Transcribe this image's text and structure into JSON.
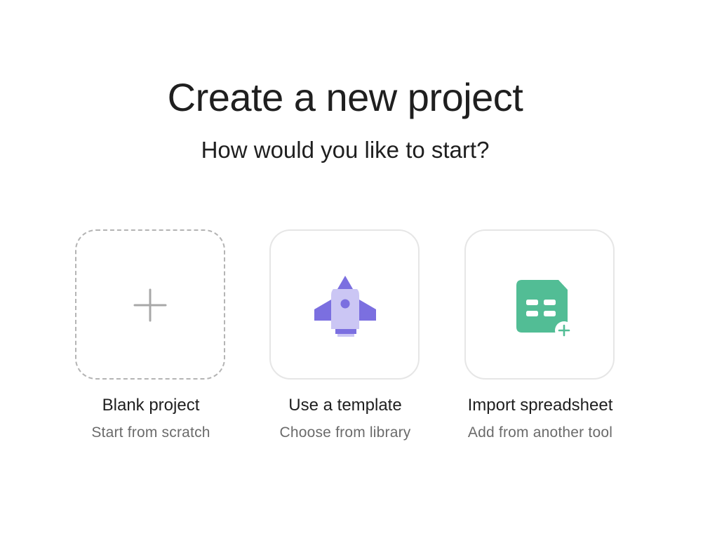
{
  "header": {
    "title": "Create a new project",
    "subtitle": "How would you like to start?"
  },
  "options": [
    {
      "label": "Blank project",
      "description": "Start from scratch",
      "icon": "plus-icon"
    },
    {
      "label": "Use a template",
      "description": "Choose from library",
      "icon": "rocket-icon"
    },
    {
      "label": "Import spreadsheet",
      "description": "Add from another tool",
      "icon": "spreadsheet-add-icon"
    }
  ],
  "colors": {
    "rocket_primary": "#7b6fe0",
    "rocket_light": "#cbc6f4",
    "spreadsheet_green": "#52bd95",
    "text_primary": "#1f1f1f",
    "text_secondary": "#6b6b6b",
    "dashed_border": "#b4b4b4",
    "tile_border": "#e6e6e6"
  }
}
